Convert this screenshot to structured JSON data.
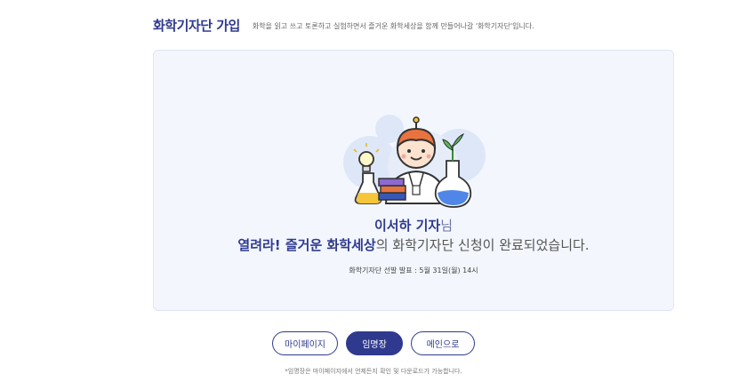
{
  "header": {
    "title": "화학기자단 가입",
    "description": "화학을 읽고 쓰고 토론하고 실험하면서 즐거운 화학세상을 함께 만들어나갈 '화학기자단'입니다."
  },
  "result": {
    "name_strong": "이서하 기자",
    "name_suffix": "님",
    "line2_strong": "열려라! 즐거운 화학세상",
    "line2_rest": "의 화학기자단 신청이 완료되었습니다.",
    "announcement": "화학기자단 선발 발표 : 5월 31일(월) 14시"
  },
  "actions": {
    "mypage_label": "마이페이지",
    "appointment_label": "임명장",
    "main_label": "메인으로"
  },
  "footnote": "*임명장은 마이페이지에서 언제든지 확인 및 다운로드가 가능합니다.",
  "colors": {
    "accent": "#2f3a8f",
    "panel_bg": "#f3f7fd"
  }
}
